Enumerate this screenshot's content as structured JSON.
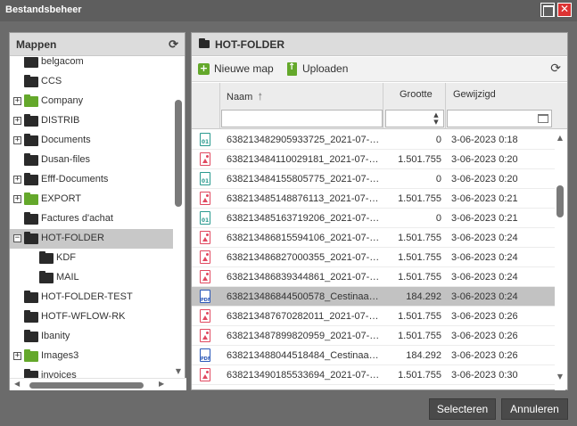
{
  "window": {
    "title": "Bestandsbeheer"
  },
  "folders_panel": {
    "title": "Mappen",
    "items": [
      {
        "label": "belgacom",
        "color": "black",
        "expander": false,
        "indent": 0
      },
      {
        "label": "CCS",
        "color": "black",
        "expander": false,
        "indent": 0
      },
      {
        "label": "Company",
        "color": "green",
        "expander": "+",
        "indent": 0
      },
      {
        "label": "DISTRIB",
        "color": "black",
        "expander": "+",
        "indent": 0
      },
      {
        "label": "Documents",
        "color": "black",
        "expander": "+",
        "indent": 0
      },
      {
        "label": "Dusan-files",
        "color": "black",
        "expander": false,
        "indent": 0
      },
      {
        "label": "Efff-Documents",
        "color": "black",
        "expander": "+",
        "indent": 0
      },
      {
        "label": "EXPORT",
        "color": "green",
        "expander": "+",
        "indent": 0
      },
      {
        "label": "Factures d'achat",
        "color": "black",
        "expander": false,
        "indent": 0
      },
      {
        "label": "HOT-FOLDER",
        "color": "black",
        "expander": "−",
        "indent": 0,
        "selected": true
      },
      {
        "label": "KDF",
        "color": "black",
        "expander": false,
        "indent": 1
      },
      {
        "label": "MAIL",
        "color": "black",
        "expander": false,
        "indent": 1
      },
      {
        "label": "HOT-FOLDER-TEST",
        "color": "black",
        "expander": false,
        "indent": 0
      },
      {
        "label": "HOTF-WFLOW-RK",
        "color": "black",
        "expander": false,
        "indent": 0
      },
      {
        "label": "Ibanity",
        "color": "black",
        "expander": false,
        "indent": 0
      },
      {
        "label": "Images3",
        "color": "green",
        "expander": "+",
        "indent": 0
      },
      {
        "label": "invoices",
        "color": "black",
        "expander": false,
        "indent": 0
      }
    ]
  },
  "files_panel": {
    "title": "HOT-FOLDER",
    "toolbar": {
      "new_folder": "Nieuwe map",
      "upload": "Uploaden"
    },
    "columns": {
      "name": "Naam",
      "size": "Grootte",
      "modified": "Gewijzigd"
    },
    "rows": [
      {
        "type": "bin",
        "name": "638213482905933725_2021-07-2...",
        "size": "0",
        "modified": "3-06-2023 0:18"
      },
      {
        "type": "img",
        "name": "638213484110029181_2021-07-2...",
        "size": "1.501.755",
        "modified": "3-06-2023 0:20"
      },
      {
        "type": "bin",
        "name": "638213484155805775_2021-07-2...",
        "size": "0",
        "modified": "3-06-2023 0:20"
      },
      {
        "type": "img",
        "name": "638213485148876113_2021-07-2...",
        "size": "1.501.755",
        "modified": "3-06-2023 0:21"
      },
      {
        "type": "bin",
        "name": "638213485163719206_2021-07-2...",
        "size": "0",
        "modified": "3-06-2023 0:21"
      },
      {
        "type": "img",
        "name": "638213486815594106_2021-07-2...",
        "size": "1.501.755",
        "modified": "3-06-2023 0:24"
      },
      {
        "type": "img",
        "name": "638213486827000355_2021-07-2...",
        "size": "1.501.755",
        "modified": "3-06-2023 0:24"
      },
      {
        "type": "img",
        "name": "638213486839344861_2021-07-2...",
        "size": "1.501.755",
        "modified": "3-06-2023 0:24"
      },
      {
        "type": "pdf",
        "name": "638213486844500578_Cestinaazr...",
        "size": "184.292",
        "modified": "3-06-2023 0:24",
        "selected": true
      },
      {
        "type": "img",
        "name": "638213487670282011_2021-07-2...",
        "size": "1.501.755",
        "modified": "3-06-2023 0:26"
      },
      {
        "type": "img",
        "name": "638213487899820959_2021-07-2...",
        "size": "1.501.755",
        "modified": "3-06-2023 0:26"
      },
      {
        "type": "pdf",
        "name": "638213488044518484_Cestinaazr...",
        "size": "184.292",
        "modified": "3-06-2023 0:26"
      },
      {
        "type": "img",
        "name": "638213490185533694_2021-07-2...",
        "size": "1.501.755",
        "modified": "3-06-2023 0:30"
      }
    ]
  },
  "footer": {
    "select": "Selecteren",
    "cancel": "Annuleren"
  },
  "colors": {
    "accent_green": "#64a82b",
    "close_red": "#d33333",
    "selection": "#c2c2c2"
  },
  "icons": {
    "refresh": "refresh-icon",
    "folder": "folder-icon",
    "sort": "sort-asc-icon"
  }
}
